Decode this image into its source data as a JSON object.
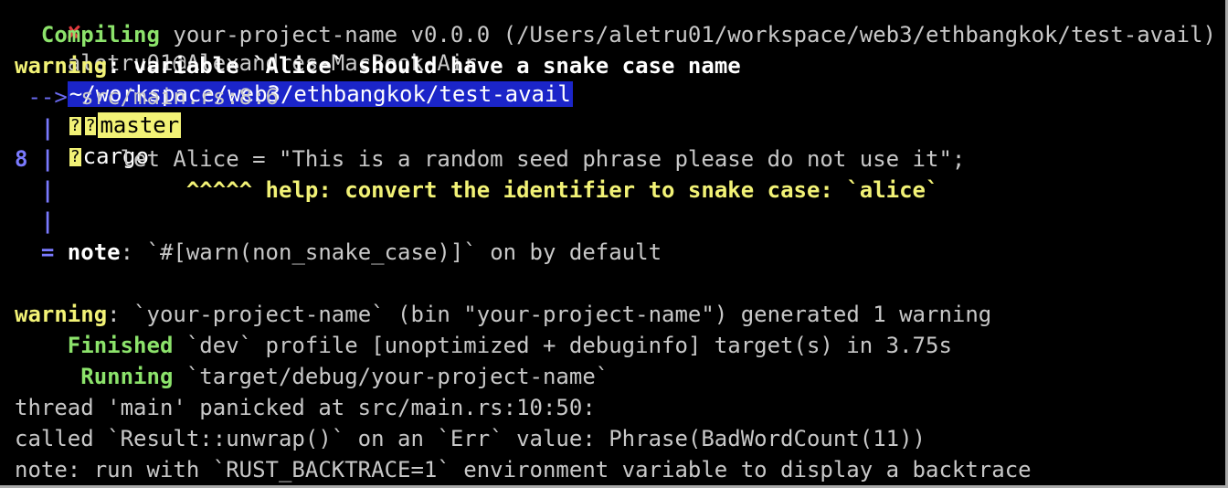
{
  "prompt": {
    "status_icon": "✘",
    "user_host": "aletru01@Alexandres-MacBook-Air",
    "path": "~/workspace/web3/ethbangkok/test-avail",
    "git_icon": "?",
    "branch_icon": "?",
    "branch": "master",
    "cargo_icon": "?",
    "command": "cargo"
  },
  "output": {
    "compiling_label": "Compiling",
    "compiling_text": " your-project-name v0.0.0 (/Users/aletru01/workspace/web3/ethbangkok/test-avail)",
    "warning1_label": "warning",
    "warning1_text": ": variable `Alice` should have a snake case name",
    "arrow": " -->",
    "location": " src/main.rs:8:6",
    "gutter_pipe1": "  |",
    "line_number": "8",
    "gutter_pipe2": " |",
    "code_line": "     let Alice = \"This is a random seed phrase please do not use it\";",
    "gutter_pipe3": "  |",
    "help_text": "          ^^^^^ help: convert the identifier to snake case: `alice`",
    "gutter_pipe4": "  |",
    "note_eq": "  =",
    "note_label": " note",
    "note_text": ": `#[warn(non_snake_case)]` on by default",
    "warning2_label": "warning",
    "warning2_text": ": `your-project-name` (bin \"your-project-name\") generated 1 warning",
    "finished_label": "    Finished",
    "finished_text": " `dev` profile [unoptimized + debuginfo] target(s) in 3.75s",
    "running_label": "     Running",
    "running_text": " `target/debug/your-project-name`",
    "panic_line": "thread 'main' panicked at src/main.rs:10:50:",
    "unwrap_line": "called `Result::unwrap()` on an `Err` value: Phrase(BadWordCount(11))",
    "note_backtrace": "note: run with `RUST_BACKTRACE=1` environment variable to display a backtrace"
  },
  "colors": {
    "background": "#000000",
    "green": "#8ce36b",
    "yellow": "#f2f276",
    "blue": "#6a6af0",
    "red": "#e0393e",
    "path_bg": "#1b25c9"
  }
}
